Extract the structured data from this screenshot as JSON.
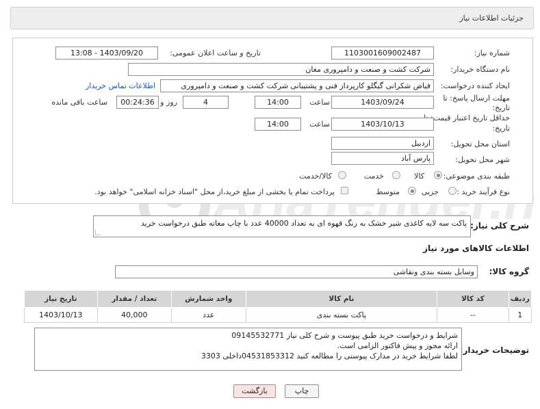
{
  "header": {
    "title": "جزئیات اطلاعات نیاز"
  },
  "form": {
    "need_number_label": "شماره نیاز:",
    "need_number": "1103001609002487",
    "announce_label": "تاریخ و ساعت اعلان عمومی:",
    "announce_value": "1403/09/20 - 13:08",
    "buyer_org_label": "نام دستگاه خریدار:",
    "buyer_org": "شرکت کشت و صنعت و دامپروری مغان",
    "creator_label": "ایجاد کننده درخواست:",
    "creator": "فیاض شکرانی گیگلو کارپرداز فنی و پشتیبانی شرکت کشت و صنعت و دامپروری",
    "contact_link": "اطلاعات تماس خریدار",
    "deadline_label_1": "مهلت ارسال پاسخ: تا",
    "deadline_label_2": "تاریخ:",
    "deadline_date": "1403/09/24",
    "time_label": "ساعت",
    "deadline_time": "14:00",
    "days_value": "4",
    "days_label": "روز و",
    "remaining_value": "00:24:36",
    "remaining_label": "ساعت باقی مانده",
    "validity_label_1": "حداقل تاریخ اعتبار قیمت: تا",
    "validity_label_2": "تاریخ:",
    "validity_date": "1403/10/13",
    "validity_time_label": "ساعت",
    "validity_time": "14:00",
    "province_label": "استان محل تحویل:",
    "province": "اردبیل",
    "city_label": "شهر محل تحویل:",
    "city": "پارس آباد",
    "category_label": "طبقه بندی موضوعی:",
    "category_options": [
      "کالا",
      "خدمت",
      "کالا/خدمت"
    ],
    "category_selected": "کالا",
    "process_label": "نوع فرآیند خرید :",
    "process_options": [
      "جزیی",
      "متوسط"
    ],
    "process_selected": "متوسط",
    "payment_note": "پرداخت تمام یا بخشی از مبلغ خرید،از محل \"اسناد خزانه اسلامی\" خواهد بود."
  },
  "summary": {
    "label": "شرح کلی نیاز:",
    "text": "پاکت سه لایه کاغذی شیر خشک به رنگ قهوه ای به تعداد 40000 عدد با چاپ مغاته طبق درخواست خرید"
  },
  "goods": {
    "section_title": "اطلاعات کالاهای مورد نیاز",
    "group_label": "گروه کالا:",
    "group_value": "وسایل بسته بندی  ونقاشی",
    "columns": [
      "ردیف",
      "کد کالا",
      "نام کالا",
      "واحد شمارش",
      "تعداد / مقدار",
      "تاریخ نیاز"
    ],
    "rows": [
      {
        "row": "1",
        "code": "--",
        "name": "پاکت بسته بندی",
        "unit": "عدد",
        "qty": "40,000",
        "date": "1403/10/13"
      }
    ]
  },
  "buyer_notes": {
    "label": "توضیحات خریدار:",
    "lines": [
      "شرایط و درخواست خرید طبق پیوست و شرح کلی نیاز 09145532771",
      "ارائه مجوز و پیش فاکتور الزامی است.",
      "لطفا شرایط خرید در مدارک پیوستی را مطالعه کنید 04531853312داخلی 3303"
    ]
  },
  "buttons": {
    "print": "چاپ",
    "back": "بازگشت"
  },
  "watermark": "AriaTender.neT",
  "colors": {
    "link": "#1a55b8",
    "back_button_bg": "#fbe3e3",
    "watermark": "#e8e8e8"
  }
}
